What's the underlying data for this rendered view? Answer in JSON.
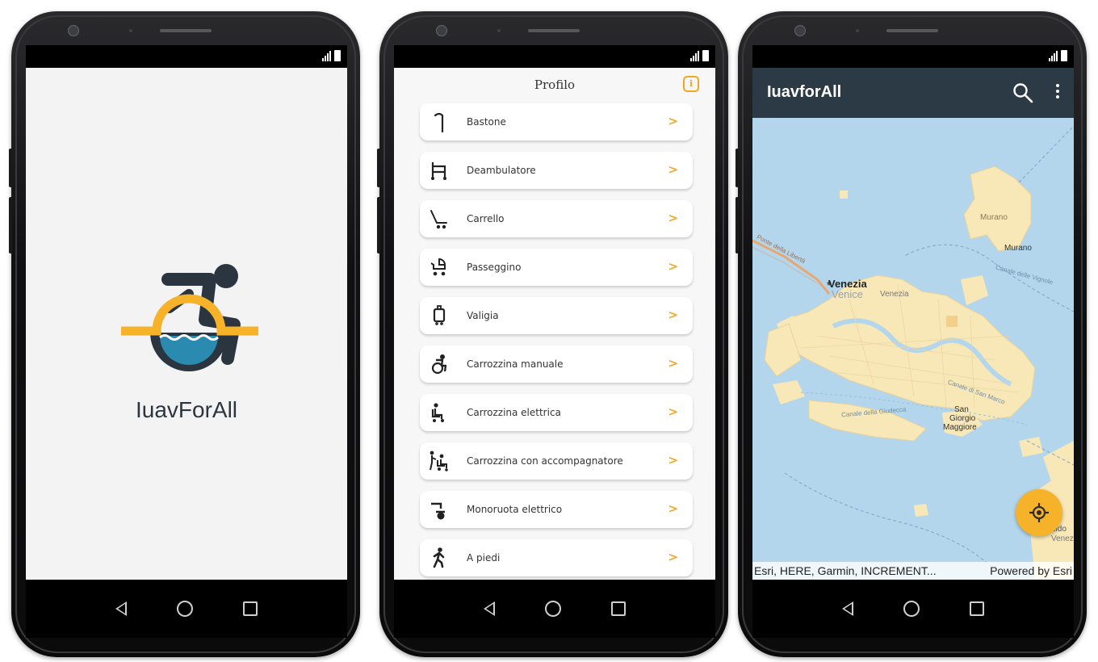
{
  "splash": {
    "app_name": "IuavForAll"
  },
  "profile": {
    "title": "Profilo",
    "info_glyph": "i",
    "items": [
      {
        "label": "Bastone",
        "icon": "cane-icon"
      },
      {
        "label": "Deambulatore",
        "icon": "walker-icon"
      },
      {
        "label": "Carrello",
        "icon": "cart-icon"
      },
      {
        "label": "Passeggino",
        "icon": "stroller-icon"
      },
      {
        "label": "Valigia",
        "icon": "suitcase-icon"
      },
      {
        "label": "Carrozzina manuale",
        "icon": "manual-wheelchair-icon"
      },
      {
        "label": "Carrozzina elettrica",
        "icon": "electric-wheelchair-icon"
      },
      {
        "label": "Carrozzina con accompagnatore",
        "icon": "assisted-wheelchair-icon"
      },
      {
        "label": "Monoruota elettrico",
        "icon": "electric-unicycle-icon"
      },
      {
        "label": "A piedi",
        "icon": "pedestrian-icon"
      }
    ],
    "chevron": ">"
  },
  "map": {
    "title": "IuavforAll",
    "attribution": "Esri, HERE, Garmin, INCREMENT...",
    "powered": "Powered by Esri",
    "labels": {
      "venezia": "Venezia",
      "venice": "Venice",
      "venezia_small": "Venezia",
      "murano1": "Murano",
      "murano2": "Murano",
      "san": "San",
      "giorgio": "Giorgio",
      "maggiore": "Maggiore",
      "lido": "Lido",
      "venez": "Venez",
      "canale_giudecca": "Canale della Giudecca",
      "canale_marco": "Canale di San Marco",
      "vigne": "Canale delle Vignole",
      "liberta": "Ponte della Libertà"
    },
    "colors": {
      "water": "#b3d6ec",
      "land": "#f8e8b8",
      "fab": "#f6b228",
      "appbar": "#2c3a46"
    }
  },
  "colors": {
    "accent": "#f5a623",
    "logo_dark": "#2b3540",
    "logo_blue": "#2a8ab0"
  }
}
